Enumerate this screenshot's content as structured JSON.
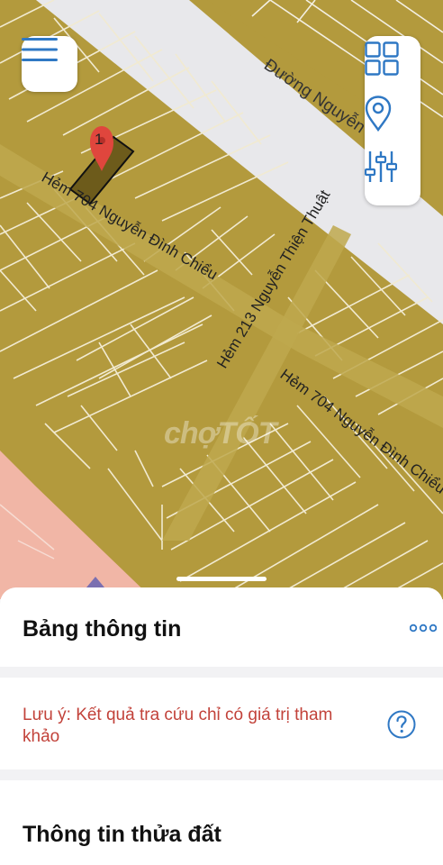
{
  "map": {
    "main_road": "Đường Nguyễn T",
    "main_road_tail": "t",
    "alley_704_upper": "Hẻm 704 Nguyễn Đình Chiểu",
    "alley_213": "Hẻm 213 Nguyễn Thiện Thuật",
    "alley_704_lower": "Hẻm 704 Nguyễn Đình Chiểu",
    "marker_number": "1",
    "watermark": "chợTỐT",
    "colors": {
      "residential": "#b39a3d",
      "road": "#e9e9ec",
      "pink_zone": "#f1b6a6",
      "selected_parcel": "#6b5a1c",
      "marker": "#e0463d"
    }
  },
  "controls": {
    "menu_icon": "hamburger-icon",
    "tools": [
      "grid-icon",
      "location-pin-icon",
      "sliders-icon"
    ]
  },
  "sheet": {
    "title": "Bảng thông tin",
    "more_icon": "more-dots-icon",
    "note": "Lưu ý: Kết quả tra cứu chỉ có giá trị tham khảo",
    "help_icon": "question-circle-icon",
    "land_title": "Thông tin thửa đất"
  }
}
